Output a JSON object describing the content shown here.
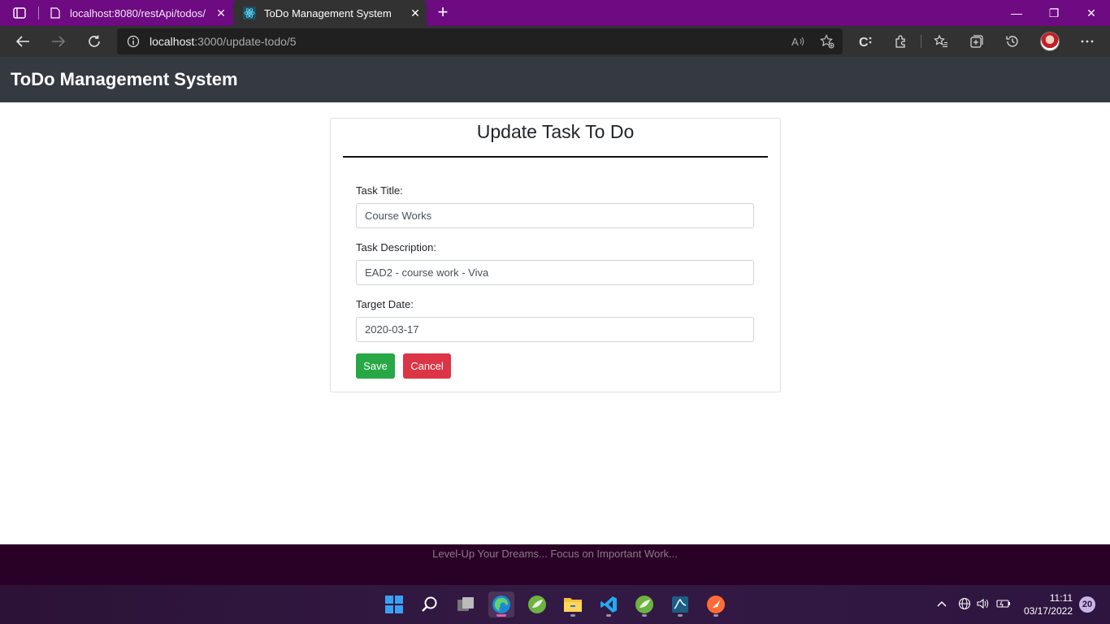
{
  "browser": {
    "tabs": [
      {
        "title": "localhost:8080/restApi/todos/",
        "icon": "page-icon",
        "active": false
      },
      {
        "title": "ToDo Management System",
        "icon": "react-icon",
        "active": true
      }
    ],
    "address": {
      "host": "localhost",
      "rest": ":3000/update-todo/5"
    },
    "accent": "#6e0a82"
  },
  "app": {
    "brand": "ToDo Management System"
  },
  "form": {
    "heading": "Update Task To Do",
    "title_label": "Task Title:",
    "title_value": "Course Works",
    "description_label": "Task Description:",
    "description_value": "EAD2 - course work - Viva",
    "date_label": "Target Date:",
    "date_value": "2020-03-17",
    "save_label": "Save",
    "cancel_label": "Cancel",
    "colors": {
      "save": "#28a745",
      "cancel": "#dc3545"
    }
  },
  "footer": {
    "text": "Level-Up Your Dreams... Focus on Important Work..."
  },
  "taskbar": {
    "time": "11:11",
    "date": "03/17/2022",
    "notifications": "20",
    "apps": [
      "start-icon",
      "search-icon",
      "task-view-icon",
      "edge-icon",
      "spring-icon",
      "file-explorer-icon",
      "vscode-icon",
      "spring-tools-icon",
      "mysql-workbench-icon",
      "postman-icon"
    ]
  }
}
